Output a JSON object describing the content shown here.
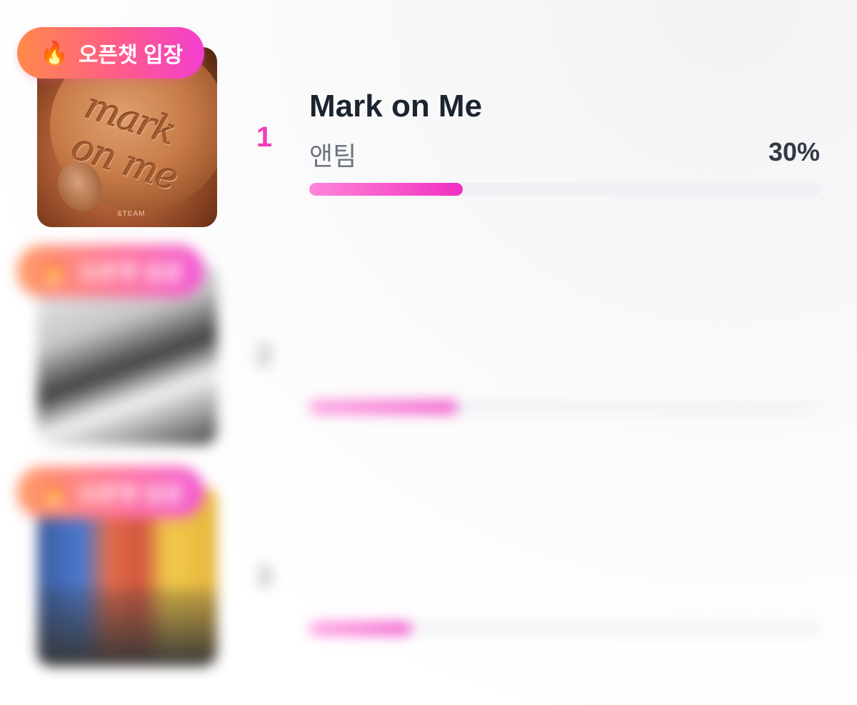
{
  "badge": {
    "icon": "fire-icon",
    "label": "오픈챗 입장"
  },
  "entries": [
    {
      "rank": "1",
      "title": "Mark on Me",
      "artist": "앤팀",
      "percent_label": "30%",
      "progress": 0.3,
      "cover_text": "&TEAM",
      "cover_script": "mark on me"
    },
    {
      "rank": "2",
      "title": "",
      "artist": "",
      "percent_label": "",
      "progress": 0.29
    },
    {
      "rank": "3",
      "title": "",
      "artist": "",
      "percent_label": "",
      "progress": 0.2
    }
  ],
  "colors": {
    "accent": "#f23fb8",
    "badge_gradient": [
      "#ff8a4a",
      "#ff5b8a",
      "#f23fd0"
    ],
    "progress_track": "#f0f1f4"
  }
}
